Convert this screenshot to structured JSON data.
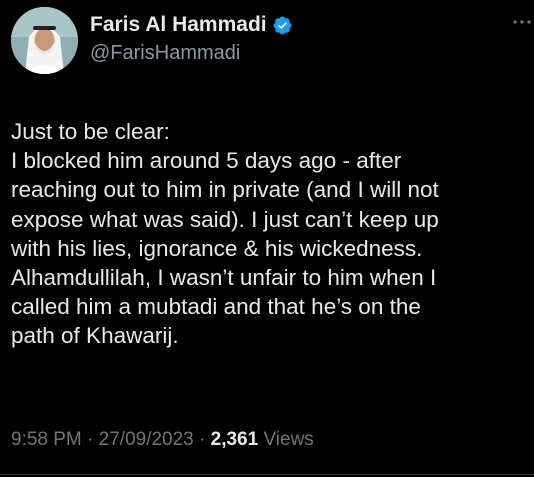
{
  "author": {
    "display_name": "Faris Al Hammadi",
    "handle": "@FarisHammadi",
    "verified_icon": "verified-badge-icon"
  },
  "tweet": {
    "lines": [
      "Just to be clear:",
      "I blocked him around 5 days ago - after",
      "reaching out to him in private (and I will not",
      "expose what was said). I just can’t keep up",
      "with his lies, ignorance & his wickedness.",
      "Alhamdullilah, I wasn’t unfair to him when I",
      "called him a mubtadi and that he’s on the",
      "path of Khawarij."
    ]
  },
  "meta": {
    "time": "9:58 PM",
    "date": "27/09/2023",
    "separator": " · ",
    "views_count": "2,361",
    "views_label": "Views"
  },
  "colors": {
    "background": "#000000",
    "text_primary": "#e7e9ea",
    "text_secondary": "#71767b",
    "verified_blue": "#1d9bf0"
  }
}
